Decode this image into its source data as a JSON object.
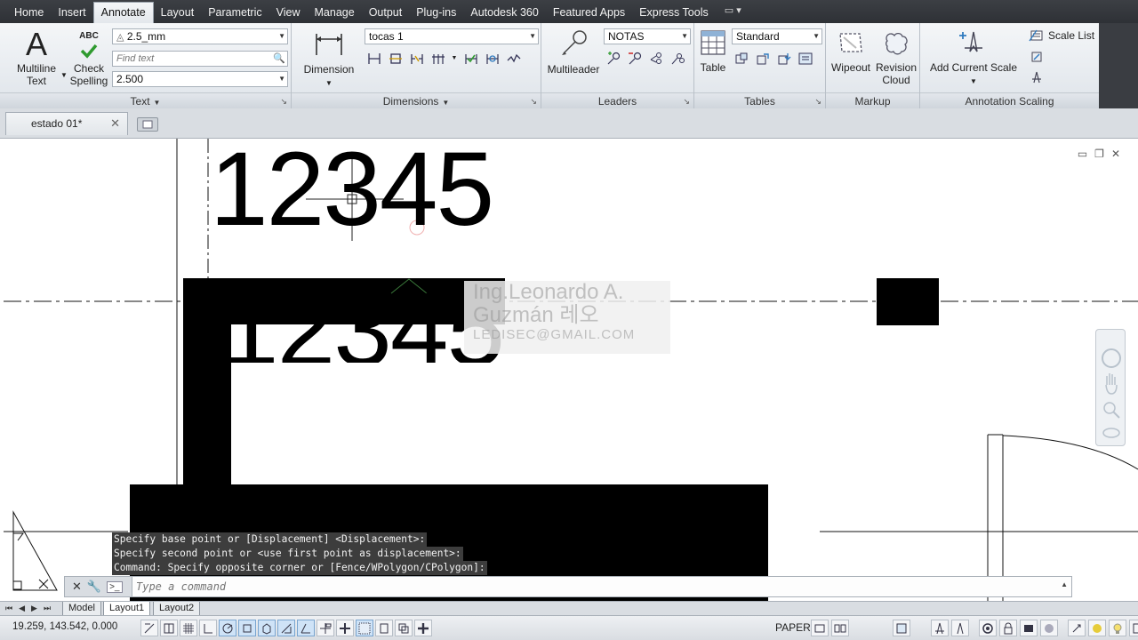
{
  "ribbon": {
    "tabs": [
      {
        "label": "Home",
        "active": false
      },
      {
        "label": "Insert",
        "active": false
      },
      {
        "label": "Annotate",
        "active": true
      },
      {
        "label": "Layout",
        "active": false
      },
      {
        "label": "Parametric",
        "active": false
      },
      {
        "label": "View",
        "active": false
      },
      {
        "label": "Manage",
        "active": false
      },
      {
        "label": "Output",
        "active": false
      },
      {
        "label": "Plug-ins",
        "active": false
      },
      {
        "label": "Autodesk 360",
        "active": false
      },
      {
        "label": "Featured Apps",
        "active": false
      },
      {
        "label": "Express Tools",
        "active": false
      }
    ],
    "text_panel": {
      "title": "Text",
      "multiline_text_line1": "Multiline",
      "multiline_text_line2": "Text",
      "check_spelling_line1": "Check",
      "check_spelling_line2": "Spelling",
      "abc_label": "ABC",
      "text_style": "2.5_mm",
      "find_text_placeholder": "Find text",
      "text_height": "2.500"
    },
    "dimensions_panel": {
      "title": "Dimensions",
      "dimension_label": "Dimension",
      "dim_style": "tocas 1"
    },
    "leaders_panel": {
      "title": "Leaders",
      "multileader_label": "Multileader",
      "leader_style": "NOTAS"
    },
    "tables_panel": {
      "title": "Tables",
      "table_label": "Table",
      "table_style": "Standard"
    },
    "markup_panel": {
      "title": "Markup",
      "wipeout_label": "Wipeout",
      "revision_cloud_line1": "Revision",
      "revision_cloud_line2": "Cloud"
    },
    "annotation_scaling_panel": {
      "title": "Annotation Scaling",
      "add_current_scale": "Add Current Scale",
      "scale_list": "Scale List"
    }
  },
  "document": {
    "tab_label": "estado 01*"
  },
  "drawing": {
    "text_top": "12345",
    "text_mid": "12345",
    "watermark_line1": "Ing.Leonardo A.",
    "watermark_line2": "Guzmán  레오",
    "watermark_line3": "LEDISEC@GMAIL.COM"
  },
  "command": {
    "history": [
      "Specify base point or [Displacement] <Displacement>:",
      "Specify second point or <use first point as displacement>:",
      "Command: Specify opposite corner or [Fence/WPolygon/CPolygon]:"
    ],
    "placeholder": "Type a command"
  },
  "layout_tabs": [
    {
      "label": "Model",
      "active": false
    },
    {
      "label": "Layout1",
      "active": true
    },
    {
      "label": "Layout2",
      "active": false
    }
  ],
  "status": {
    "coordinates": "19.259, 143.542, 0.000",
    "space": "PAPER"
  }
}
